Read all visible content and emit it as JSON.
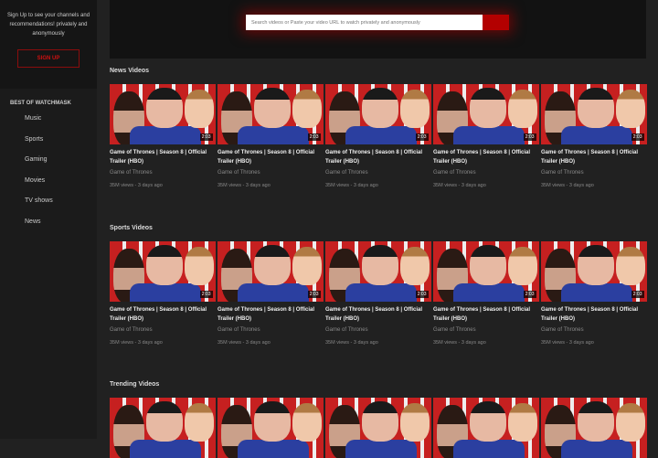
{
  "sidebar": {
    "signup_text": "Sign Up to see your channels and recommendations! privately and anonymously",
    "signup_label": "SIGN UP",
    "best_title": "BEST OF WATCHMASK",
    "items": [
      {
        "label": "Music"
      },
      {
        "label": "Sports"
      },
      {
        "label": "Gaming"
      },
      {
        "label": "Movies"
      },
      {
        "label": "TV shows"
      },
      {
        "label": "News"
      }
    ]
  },
  "search": {
    "placeholder": "Search videos or Paste your video URL to watch privately and anonymously"
  },
  "colors": {
    "accent": "#b30000"
  },
  "sections": [
    {
      "title": "News Videos",
      "videos": [
        {
          "title": "Game of Thrones | Season 8 | Official Trailer (HBO)",
          "channel": "Game of Thrones",
          "meta": "35M views - 3 days ago",
          "duration": "2:03"
        },
        {
          "title": "Game of Thrones | Season 8 | Official Trailer (HBO)",
          "channel": "Game of Thrones",
          "meta": "35M views - 3 days ago",
          "duration": "2:03"
        },
        {
          "title": "Game of Thrones | Season 8 | Official Trailer (HBO)",
          "channel": "Game of Thrones",
          "meta": "35M views - 3 days ago",
          "duration": "2:03"
        },
        {
          "title": "Game of Thrones | Season 8 | Official Trailer (HBO)",
          "channel": "Game of Thrones",
          "meta": "35M views - 3 days ago",
          "duration": "2:03"
        },
        {
          "title": "Game of Thrones | Season 8 | Official Trailer (HBO)",
          "channel": "Game of Thrones",
          "meta": "35M views - 3 days ago",
          "duration": "2:03"
        }
      ]
    },
    {
      "title": "Sports Videos",
      "videos": [
        {
          "title": "Game of Thrones | Season 8 | Official Trailer (HBO)",
          "channel": "Game of Thrones",
          "meta": "35M views - 3 days ago",
          "duration": "2:03"
        },
        {
          "title": "Game of Thrones | Season 8 | Official Trailer (HBO)",
          "channel": "Game of Thrones",
          "meta": "35M views - 3 days ago",
          "duration": "2:03"
        },
        {
          "title": "Game of Thrones | Season 8 | Official Trailer (HBO)",
          "channel": "Game of Thrones",
          "meta": "35M views - 3 days ago",
          "duration": "2:03"
        },
        {
          "title": "Game of Thrones | Season 8 | Official Trailer (HBO)",
          "channel": "Game of Thrones",
          "meta": "35M views - 3 days ago",
          "duration": "2:03"
        },
        {
          "title": "Game of Thrones | Season 8 | Official Trailer (HBO)",
          "channel": "Game of Thrones",
          "meta": "35M views - 3 days ago",
          "duration": "2:03"
        }
      ]
    },
    {
      "title": "Trending Videos",
      "videos": [
        {
          "title": "",
          "channel": "",
          "meta": "",
          "duration": ""
        },
        {
          "title": "",
          "channel": "",
          "meta": "",
          "duration": ""
        },
        {
          "title": "",
          "channel": "",
          "meta": "",
          "duration": ""
        },
        {
          "title": "",
          "channel": "",
          "meta": "",
          "duration": ""
        },
        {
          "title": "",
          "channel": "",
          "meta": "",
          "duration": ""
        }
      ]
    }
  ]
}
